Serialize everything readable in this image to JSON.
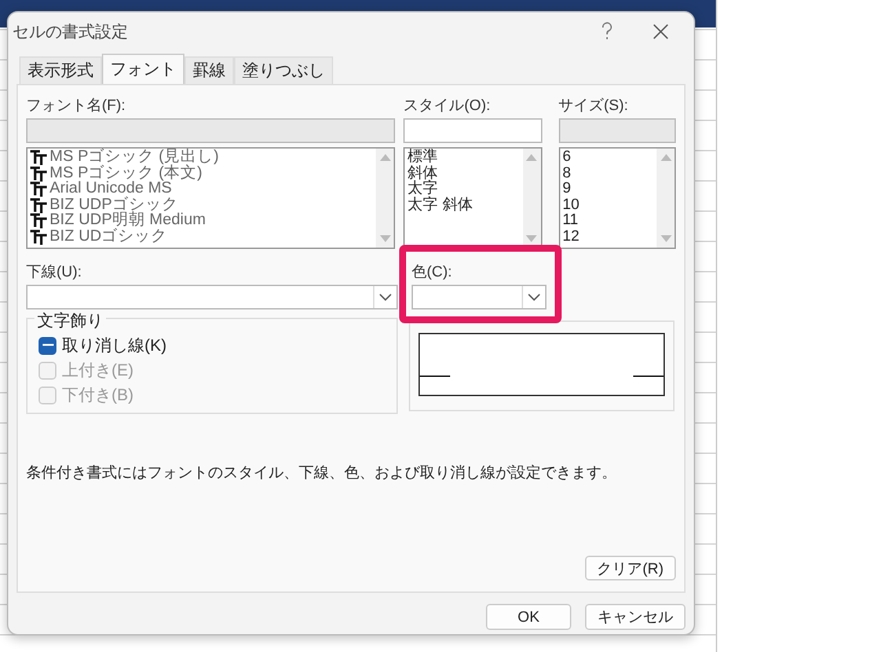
{
  "window": {
    "title": "セルの書式設定"
  },
  "tabs": [
    {
      "label": "表示形式",
      "selected": false
    },
    {
      "label": "フォント",
      "selected": true
    },
    {
      "label": "罫線",
      "selected": false
    },
    {
      "label": "塗りつぶし",
      "selected": false
    }
  ],
  "font_name": {
    "label": "フォント名(F):",
    "items": [
      "MS Pゴシック (見出し)",
      "MS Pゴシック (本文)",
      "Arial Unicode MS",
      "BIZ UDPゴシック",
      "BIZ UDP明朝 Medium",
      "BIZ UDゴシック"
    ]
  },
  "style": {
    "label": "スタイル(O):",
    "items": [
      "標準",
      "斜体",
      "太字",
      "太字 斜体"
    ]
  },
  "size": {
    "label": "サイズ(S):",
    "items": [
      "6",
      "8",
      "9",
      "10",
      "11",
      "12"
    ]
  },
  "underline": {
    "label": "下線(U):"
  },
  "color": {
    "label": "色(C):",
    "highlighted": true
  },
  "effects": {
    "title": "文字飾り",
    "options": [
      {
        "label": "取り消し線(K)",
        "indeterminate": true,
        "disabled": false
      },
      {
        "label": "上付き(E)",
        "indeterminate": false,
        "disabled": true
      },
      {
        "label": "下付き(B)",
        "indeterminate": false,
        "disabled": true
      }
    ]
  },
  "note": "条件付き書式にはフォントのスタイル、下線、色、および取り消し線が設定できます。",
  "clear_button": "クリア(R)",
  "buttons": [
    "OK",
    "キャンセル"
  ]
}
